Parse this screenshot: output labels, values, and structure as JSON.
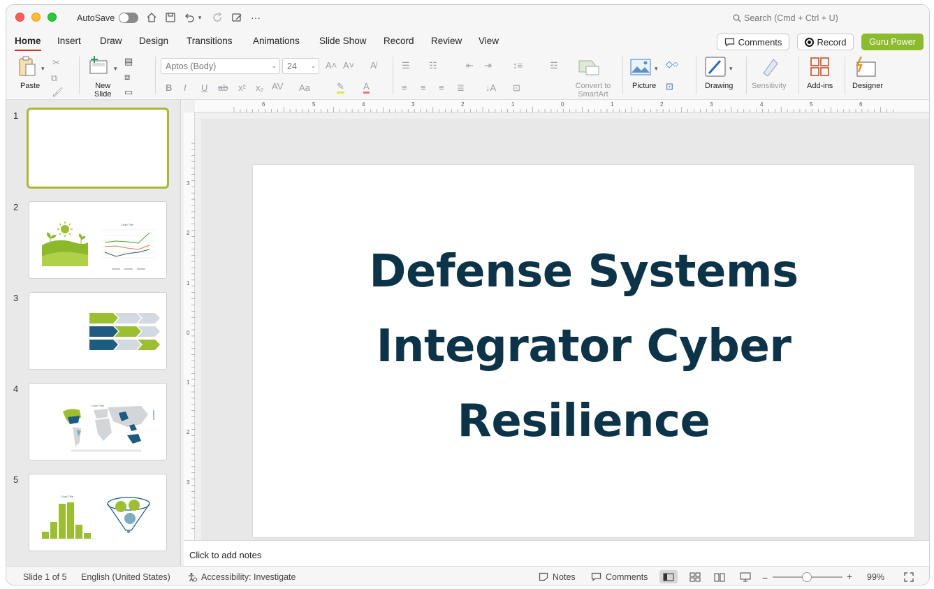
{
  "titlebar": {
    "autosave_label": "AutoSave",
    "search_placeholder": "Search (Cmd + Ctrl + U)"
  },
  "tabs": [
    {
      "label": "Home",
      "active": true
    },
    {
      "label": "Insert"
    },
    {
      "label": "Draw"
    },
    {
      "label": "Design"
    },
    {
      "label": "Transitions"
    },
    {
      "label": "Animations"
    },
    {
      "label": "Slide Show"
    },
    {
      "label": "Record"
    },
    {
      "label": "Review"
    },
    {
      "label": "View"
    }
  ],
  "actions": {
    "comments_label": "Comments",
    "record_label": "Record",
    "guru_label": "Guru Power"
  },
  "ribbon": {
    "paste_label": "Paste",
    "new_slide_label": "New\nSlide",
    "font_name": "Aptos (Body)",
    "font_size": "24",
    "convert_label": "Convert to\nSmartArt",
    "picture_label": "Picture",
    "drawing_label": "Drawing",
    "sensitivity_label": "Sensitivity",
    "addins_label": "Add-ins",
    "designer_label": "Designer"
  },
  "slides": [
    {
      "number": "1"
    },
    {
      "number": "2"
    },
    {
      "number": "3"
    },
    {
      "number": "4"
    },
    {
      "number": "5"
    }
  ],
  "ruler": {
    "h_labels": [
      "6",
      "5",
      "4",
      "3",
      "2",
      "1",
      "0",
      "1",
      "2",
      "3",
      "4",
      "5",
      "6"
    ],
    "v_labels": [
      "3",
      "2",
      "1",
      "0",
      "1",
      "2",
      "3"
    ]
  },
  "slide": {
    "title": "Defense Systems Integrator Cyber Resilience"
  },
  "notes": {
    "placeholder": "Click to add notes"
  },
  "status": {
    "slide_position": "Slide 1 of 5",
    "language": "English (United States)",
    "accessibility": "Accessibility: Investigate",
    "notes_label": "Notes",
    "comments_label": "Comments",
    "zoom": "99%"
  },
  "colors": {
    "accent_green": "#8dbb2e",
    "title_navy": "#0c3348",
    "tab_underline": "#c23b22"
  }
}
